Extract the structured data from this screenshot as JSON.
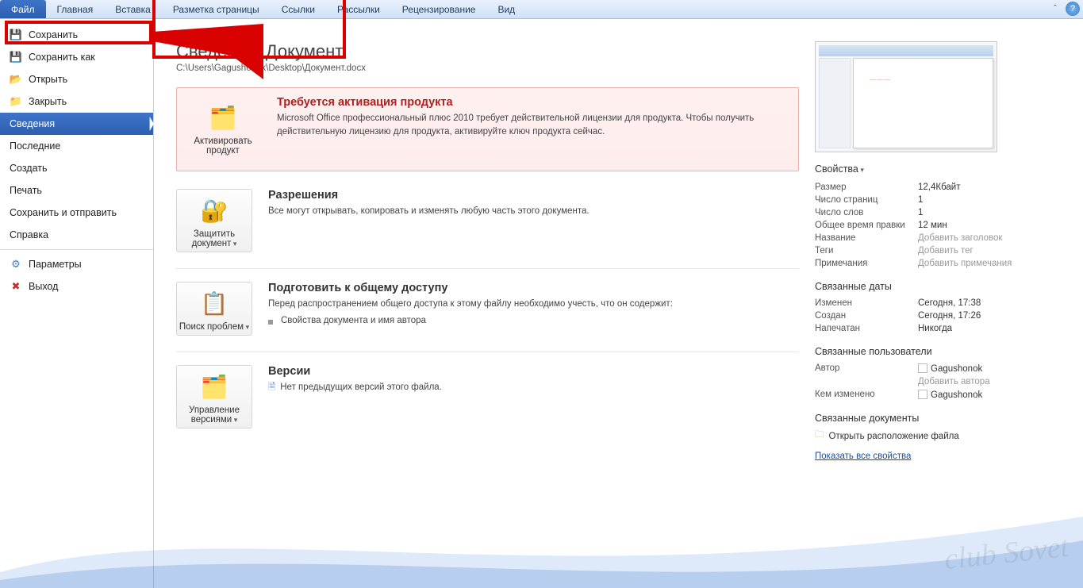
{
  "ribbon": {
    "tabs": [
      "Файл",
      "Главная",
      "Вставка",
      "Разметка страницы",
      "Ссылки",
      "Рассылки",
      "Рецензирование",
      "Вид"
    ],
    "active": 0
  },
  "sidebar": {
    "items": [
      {
        "label": "Сохранить",
        "icon": "💾"
      },
      {
        "label": "Сохранить как",
        "icon": "💾"
      },
      {
        "label": "Открыть",
        "icon": "📂"
      },
      {
        "label": "Закрыть",
        "icon": "📁"
      },
      {
        "label": "Сведения"
      },
      {
        "label": "Последние"
      },
      {
        "label": "Создать"
      },
      {
        "label": "Печать"
      },
      {
        "label": "Сохранить и отправить"
      },
      {
        "label": "Справка"
      },
      {
        "label": "Параметры",
        "icon": "⚙"
      },
      {
        "label": "Выход",
        "icon": "✖"
      }
    ],
    "selected": 4
  },
  "info": {
    "title": "Сведения: Документ",
    "path": "C:\\Users\\Gagushonok\\Desktop\\Документ.docx",
    "activation": {
      "btn": "Активировать продукт",
      "title": "Требуется активация продукта",
      "text": "Microsoft Office профессиональный плюс 2010 требует действительной лицензии для продукта. Чтобы получить действительную лицензию для продукта, активируйте ключ продукта сейчас."
    },
    "perm": {
      "btn": "Защитить документ",
      "title": "Разрешения",
      "text": "Все могут открывать, копировать и изменять любую часть этого документа."
    },
    "share": {
      "btn": "Поиск проблем",
      "title": "Подготовить к общему доступу",
      "text": "Перед распространением общего доступа к этому файлу необходимо учесть, что он содержит:",
      "bullet": "Свойства документа и имя автора"
    },
    "versions": {
      "btn": "Управление версиями",
      "title": "Версии",
      "text": "Нет предыдущих версий этого файла."
    }
  },
  "props": {
    "header": "Свойства",
    "rows": [
      {
        "k": "Размер",
        "v": "12,4Кбайт"
      },
      {
        "k": "Число страниц",
        "v": "1"
      },
      {
        "k": "Число слов",
        "v": "1"
      },
      {
        "k": "Общее время правки",
        "v": "12 мин"
      },
      {
        "k": "Название",
        "v": "Добавить заголовок",
        "ghost": true
      },
      {
        "k": "Теги",
        "v": "Добавить тег",
        "ghost": true
      },
      {
        "k": "Примечания",
        "v": "Добавить примечания",
        "ghost": true
      }
    ],
    "dates_hdr": "Связанные даты",
    "dates": [
      {
        "k": "Изменен",
        "v": "Сегодня, 17:38"
      },
      {
        "k": "Создан",
        "v": "Сегодня, 17:26"
      },
      {
        "k": "Напечатан",
        "v": "Никогда"
      }
    ],
    "people_hdr": "Связанные пользователи",
    "author_k": "Автор",
    "author_v": "Gagushonok",
    "add_author": "Добавить автора",
    "changed_k": "Кем изменено",
    "changed_v": "Gagushonok",
    "docs_hdr": "Связанные документы",
    "open_loc": "Открыть расположение файла",
    "show_all": "Показать все свойства"
  },
  "watermark": "club Sovet"
}
